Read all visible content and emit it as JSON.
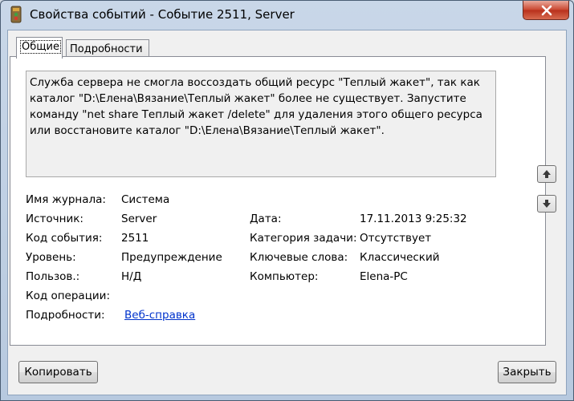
{
  "window": {
    "title": "Свойства событий - Событие 2511, Server"
  },
  "tabs": [
    {
      "label": "Общие",
      "active": true
    },
    {
      "label": "Подробности",
      "active": false
    }
  ],
  "description": "Служба сервера не смогла воссоздать общий ресурс \"Теплый жакет\", так как каталог \"D:\\Елена\\Вязание\\Теплый жакет\" более не существует. Запустите команду \"net share Теплый жакет /delete\" для удаления этого общего ресурса или восстановите каталог \"D:\\Елена\\Вязание\\Теплый жакет\".",
  "fields": {
    "log_name": {
      "label": "Имя журнала:",
      "value": "Система"
    },
    "source": {
      "label": "Источник:",
      "value": "Server"
    },
    "event_id": {
      "label": "Код события:",
      "value": "2511"
    },
    "level": {
      "label": "Уровень:",
      "value": "Предупреждение"
    },
    "user": {
      "label": "Пользов.:",
      "value": "Н/Д"
    },
    "opcode": {
      "label": "Код операции:",
      "value": ""
    },
    "more_info": {
      "label": "Подробности:",
      "value": "Веб-справка "
    },
    "date": {
      "label": "Дата:",
      "value": "17.11.2013 9:25:32"
    },
    "task_category": {
      "label": "Категория задачи:",
      "value": "Отсутствует"
    },
    "keywords": {
      "label": "Ключевые слова:",
      "value": "Классический"
    },
    "computer": {
      "label": "Компьютер:",
      "value": "Elena-PC"
    }
  },
  "buttons": {
    "copy": "Копировать",
    "close": "Закрыть"
  }
}
